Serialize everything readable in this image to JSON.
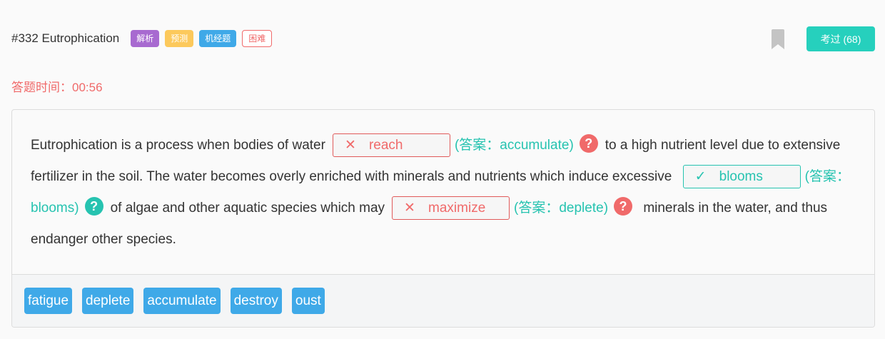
{
  "question": {
    "title": "#332 Eutrophication",
    "tags": [
      "解析",
      "预测",
      "机经题",
      "困难"
    ],
    "done_button": "考过 (68)",
    "timer": "答题时间：00:56"
  },
  "passage": {
    "p1": "Eutrophication is a process when bodies of water",
    "p2": "to a high nutrient level due to extensive fertilizer in the soil. The water becomes overly enriched with minerals and nutrients which induce excessive",
    "p3": "of algae and other aquatic species which may",
    "p4": "minerals in the water, and thus endanger other species.",
    "blanks": [
      {
        "mark": "✕",
        "value": "reach",
        "answer": "(答案：accumulate)",
        "status": "wrong"
      },
      {
        "mark": "✓",
        "value": "blooms",
        "answer": "(答案：blooms)",
        "status": "correct"
      },
      {
        "mark": "✕",
        "value": "maximize",
        "answer": "(答案：deplete)",
        "status": "wrong"
      }
    ],
    "help_glyph": "?"
  },
  "options": [
    "fatigue",
    "deplete",
    "accumulate",
    "destroy",
    "oust"
  ],
  "colors": {
    "teal": "#26c3b0",
    "red": "#f06a6a",
    "blue": "#3fa9e8",
    "purple": "#a86ad0",
    "yellow": "#fcc95c"
  }
}
